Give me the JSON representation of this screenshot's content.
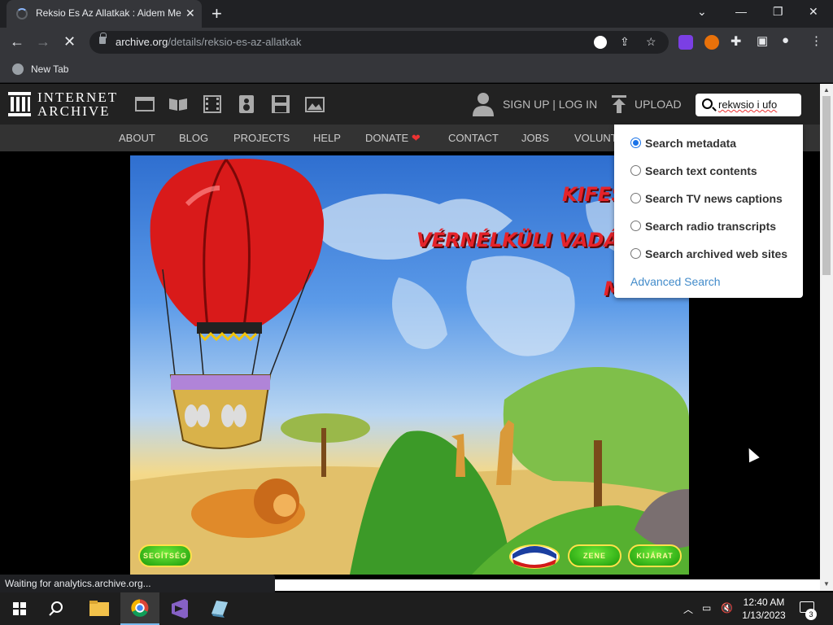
{
  "browser": {
    "tab_title": "Reksio Es Az Allatkak : Aidem Me",
    "tab_close": "✕",
    "new_tab": "+",
    "url_host": "archive.org",
    "url_path": "/details/reksio-es-az-allatkak",
    "bookmark_label": "New Tab",
    "status_text": "Waiting for analytics.archive.org...",
    "icons": [
      "back-icon",
      "forward-icon",
      "stop-icon",
      "lock-icon",
      "google-icon",
      "share-icon",
      "star-icon",
      "extensions-icon",
      "sidepanel-icon",
      "profile-icon",
      "menu-icon"
    ]
  },
  "ia": {
    "logo_line1": "INTERNET",
    "logo_line2": "ARCHIVE",
    "signup": "SIGN UP | LOG IN",
    "upload": "UPLOAD",
    "search_query": "rekwsio i ufo",
    "nav": [
      "ABOUT",
      "BLOG",
      "PROJECTS",
      "HELP",
      "DONATE",
      "CONTACT",
      "JOBS",
      "VOLUNT"
    ],
    "heart": "❤"
  },
  "dropdown": {
    "options": [
      {
        "label": "Search metadata",
        "selected": true
      },
      {
        "label": "Search text contents",
        "selected": false
      },
      {
        "label": "Search TV news captions",
        "selected": false
      },
      {
        "label": "Search radio transcripts",
        "selected": false
      },
      {
        "label": "Search archived web sites",
        "selected": false
      }
    ],
    "advanced": "Advanced Search"
  },
  "game": {
    "title_line1": "KIFES",
    "title_line2": "VÉRNÉLKÜLI VADÁS",
    "title_line3": "M",
    "btn_help": "SEGÍTSÉG",
    "btn_music": "ZENE",
    "btn_exit": "KIJÁRAT"
  },
  "taskbar": {
    "time": "12:40 AM",
    "date": "1/13/2023",
    "notifications": "3"
  },
  "colors": {
    "chrome_dark": "#202124",
    "chrome_mid": "#35363a",
    "ia_header": "#222222",
    "ia_nav": "#333333",
    "link_blue": "#428bca",
    "radio_blue": "#1a73e8"
  }
}
